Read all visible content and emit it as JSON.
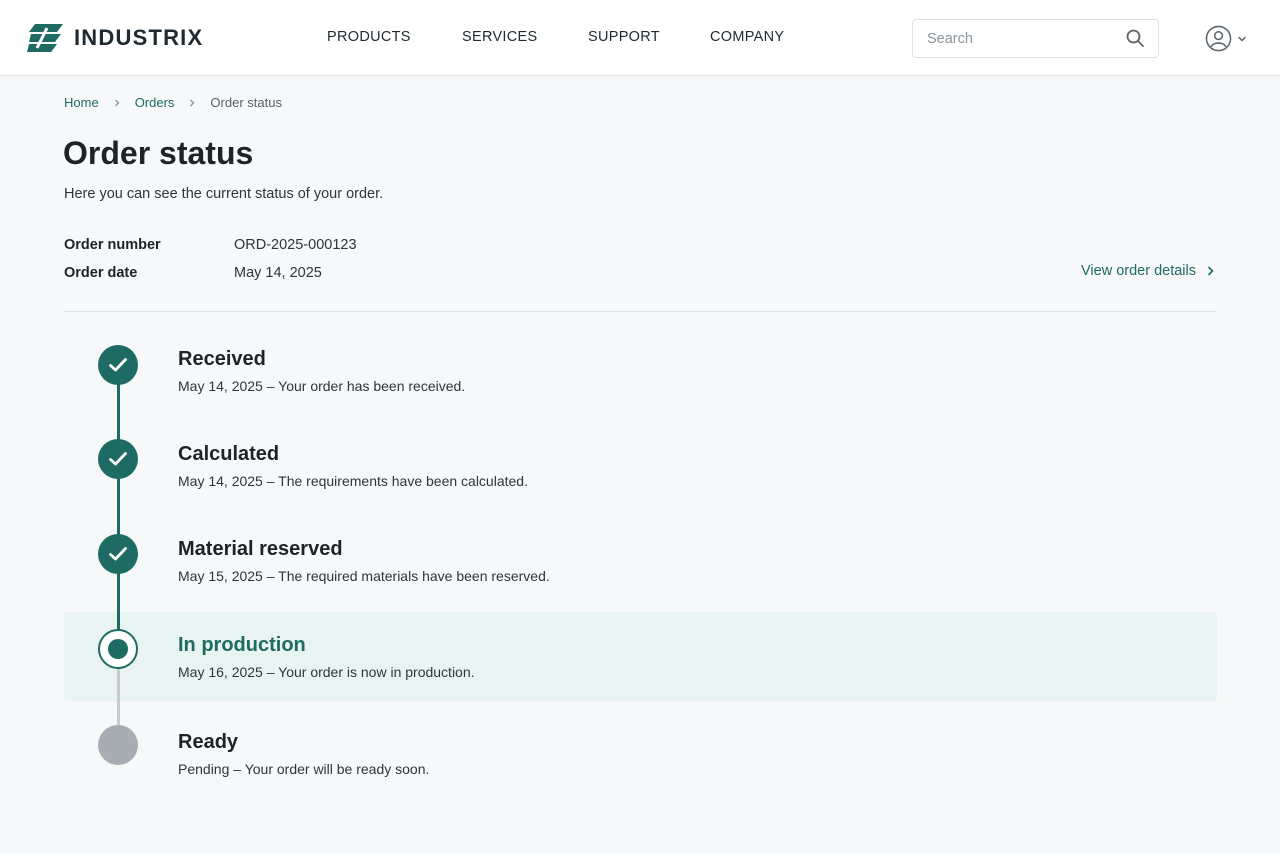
{
  "brand": {
    "name": "INDUSTRIX",
    "color": "#1e6b63"
  },
  "nav": {
    "items": [
      {
        "label": "PRODUCTS"
      },
      {
        "label": "SERVICES"
      },
      {
        "label": "SUPPORT"
      },
      {
        "label": "COMPANY"
      }
    ]
  },
  "search": {
    "placeholder": "Search",
    "value": "",
    "icon": "search-icon"
  },
  "user": {
    "icon": "user-circle-icon",
    "dropdown_icon": "chevron-down-icon"
  },
  "breadcrumb": {
    "home": "Home",
    "orders": "Orders",
    "current": "Order status"
  },
  "page": {
    "title": "Order status",
    "subtitle": "Here you can see the current status of your order."
  },
  "order": {
    "number_label": "Order number",
    "number_value": "ORD-2025-000123",
    "date_label": "Order date",
    "date_value": "May 14, 2025",
    "details_link": "View order details"
  },
  "timeline": {
    "colors": {
      "done": "#1e6b63",
      "pending": "#a7adb2",
      "active_bg": "#e9f4f2"
    },
    "steps": [
      {
        "title": "Received",
        "description": "May 14, 2025 – Your order has been received.",
        "state": "done"
      },
      {
        "title": "Calculated",
        "description": "May 14, 2025 – The requirements have been calculated.",
        "state": "done"
      },
      {
        "title": "Material reserved",
        "description": "May 15, 2025 – The required materials have been reserved.",
        "state": "done"
      },
      {
        "title": "In production",
        "description": "May 16, 2025 – Your order is now in production.",
        "state": "current"
      },
      {
        "title": "Ready",
        "description": "Pending – Your order will be ready soon.",
        "state": "pending"
      }
    ]
  }
}
